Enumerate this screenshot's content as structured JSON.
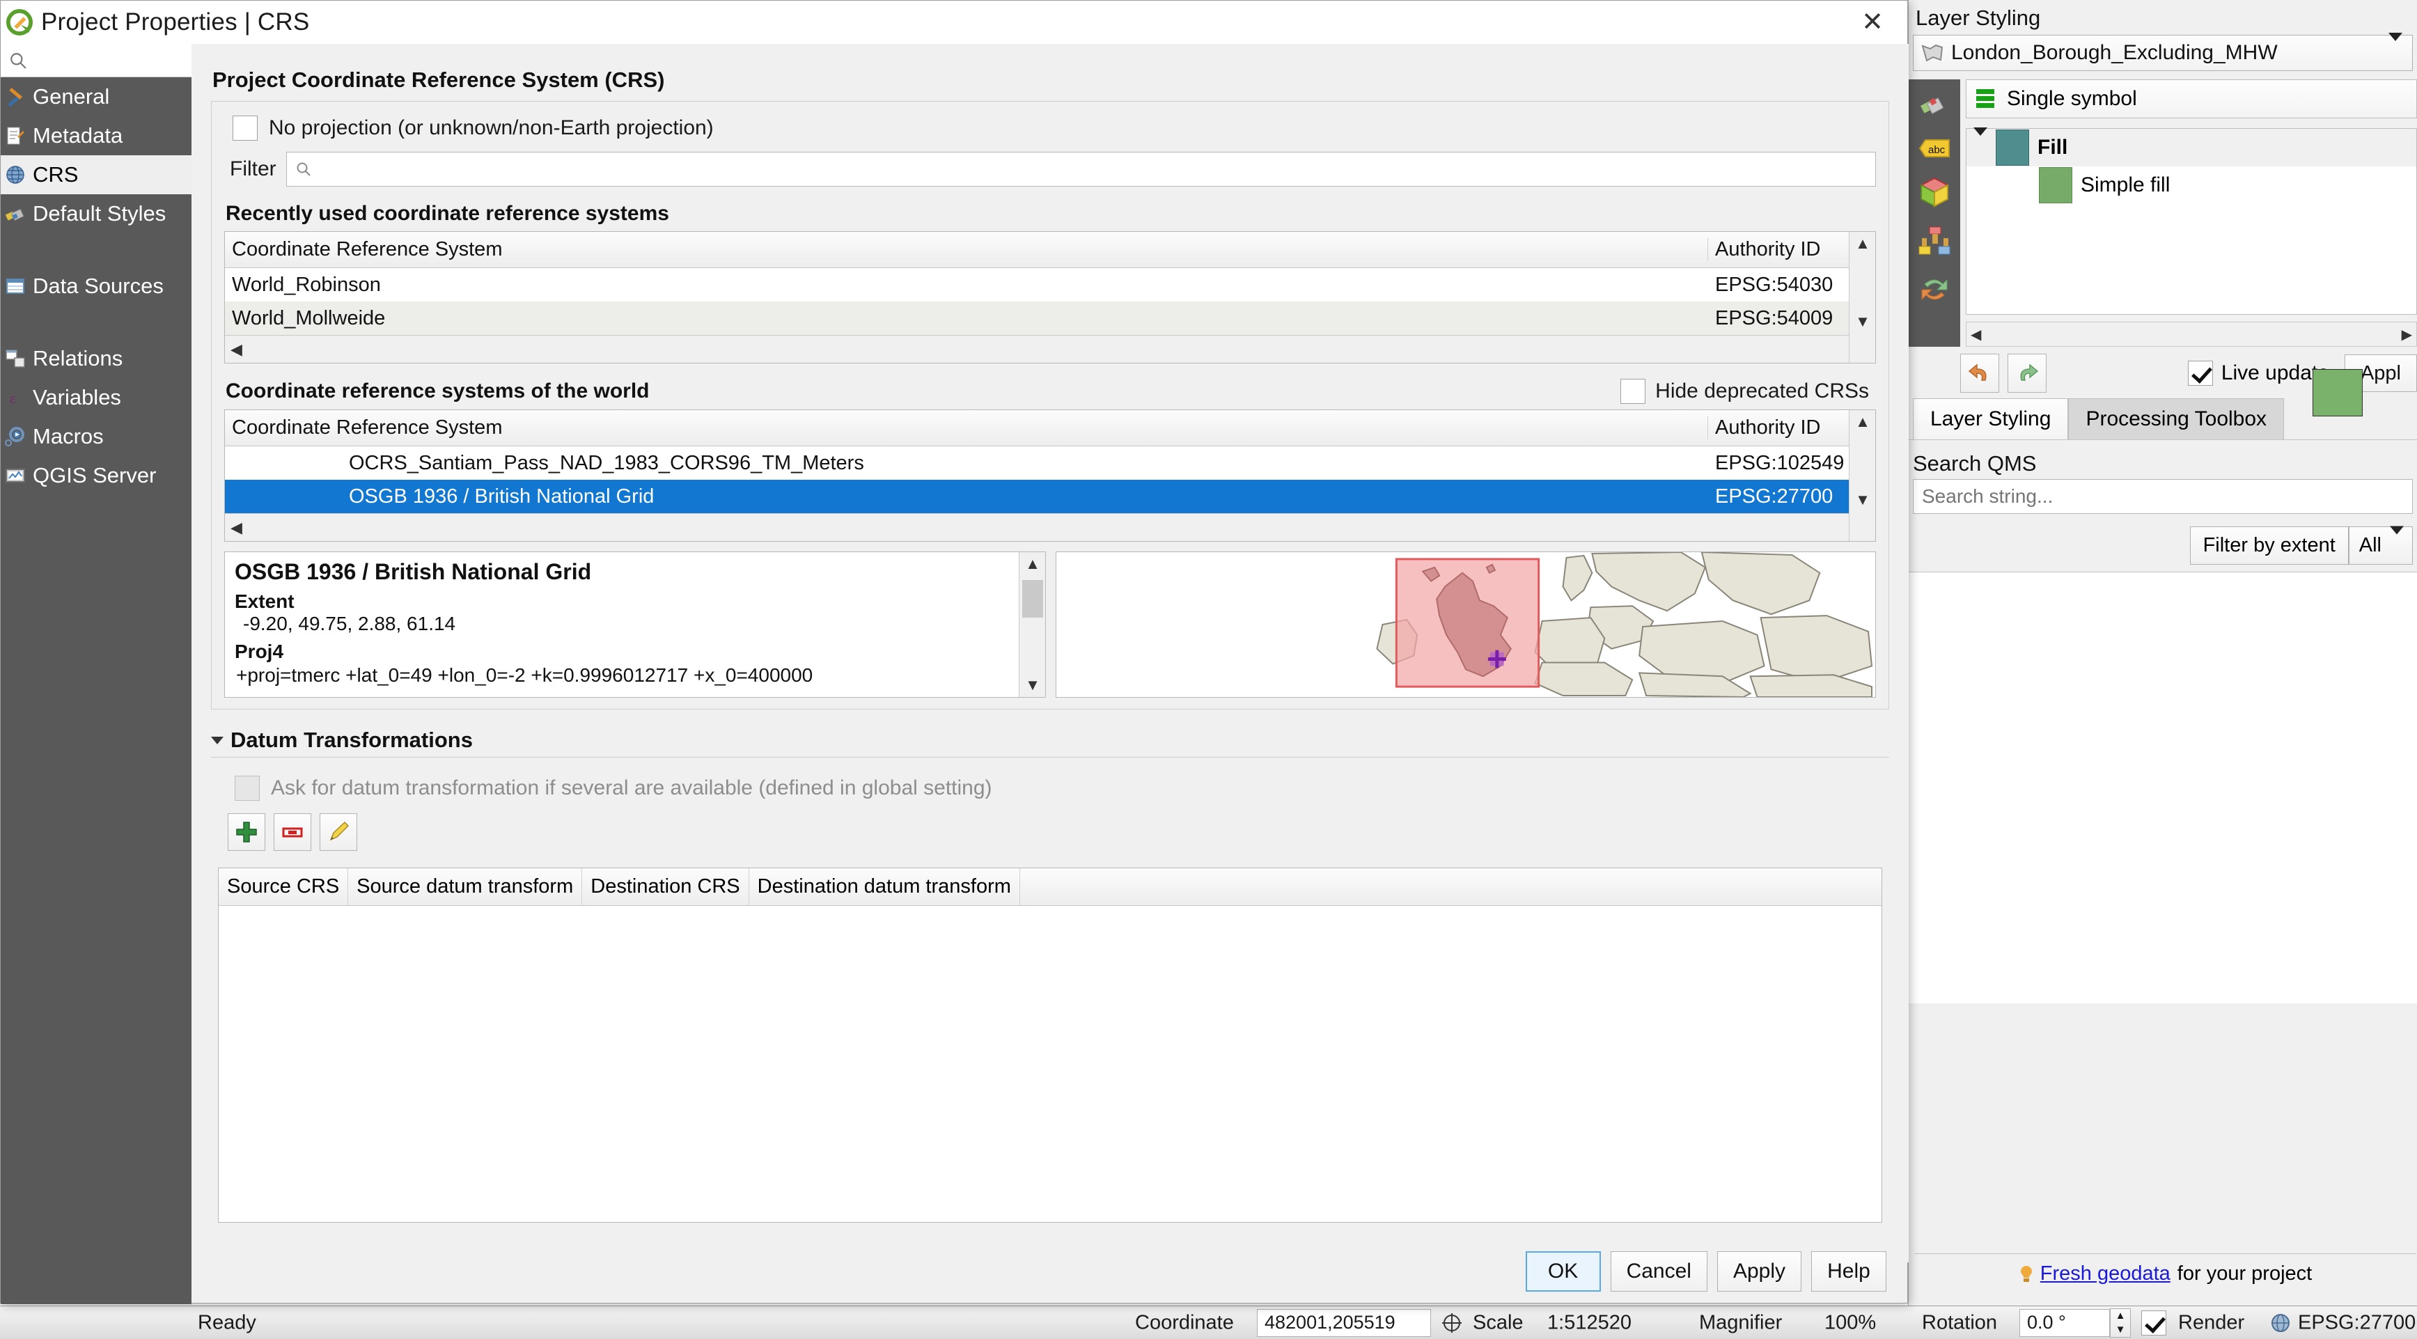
{
  "dialog": {
    "title": "Project Properties | CRS",
    "close_icon": "close-icon",
    "search_placeholder": "",
    "sidebar": [
      {
        "label": "General",
        "icon": "tools-icon",
        "active": false
      },
      {
        "label": "Metadata",
        "icon": "document-edit-icon",
        "active": false
      },
      {
        "label": "CRS",
        "icon": "globe-icon",
        "active": true
      },
      {
        "label": "Default Styles",
        "icon": "paintbrush-icon",
        "active": false
      },
      {
        "label": "Data Sources",
        "icon": "table-icon",
        "active": false
      },
      {
        "label": "Relations",
        "icon": "relations-icon",
        "active": false
      },
      {
        "label": "Variables",
        "icon": "epsilon-icon",
        "active": false
      },
      {
        "label": "Macros",
        "icon": "macro-gear-icon",
        "active": false
      },
      {
        "label": "QGIS Server",
        "icon": "server-image-icon",
        "active": false
      }
    ],
    "page_title": "Project Coordinate Reference System (CRS)",
    "no_projection_label": "No projection (or unknown/non-Earth projection)",
    "no_projection_checked": false,
    "filter_label": "Filter",
    "filter_value": "",
    "filter_placeholder": "",
    "recent_title": "Recently used coordinate reference systems",
    "world_title": "Coordinate reference systems of the world",
    "hide_deprecated_label": "Hide deprecated CRSs",
    "hide_deprecated_checked": false,
    "table_columns": [
      "Coordinate Reference System",
      "Authority ID"
    ],
    "recent_rows": [
      {
        "crs": "World_Robinson",
        "authority": "EPSG:54030",
        "selected": false
      },
      {
        "crs": "World_Mollweide",
        "authority": "EPSG:54009",
        "selected": false
      }
    ],
    "world_rows": [
      {
        "crs": "OCRS_Santiam_Pass_NAD_1983_CORS96_TM_Meters",
        "authority": "EPSG:102549",
        "selected": false
      },
      {
        "crs": "OSGB 1936 / British National Grid",
        "authority": "EPSG:27700",
        "selected": true
      }
    ],
    "detail": {
      "title": "OSGB 1936 / British National Grid",
      "extent_label": "Extent",
      "extent_value": "-9.20, 49.75, 2.88, 61.14",
      "proj4_label": "Proj4",
      "proj4_value": "+proj=tmerc +lat_0=49 +lon_0=-2 +k=0.9996012717 +x_0=400000"
    },
    "datum": {
      "section_label": "Datum Transformations",
      "ask_label": "Ask for datum transformation if several are available (defined in global setting)",
      "ask_checked": false,
      "buttons": [
        "add-datum-transform",
        "remove-datum-transform",
        "edit-datum-transform"
      ],
      "columns": [
        "Source CRS",
        "Source datum transform",
        "Destination CRS",
        "Destination datum transform"
      ],
      "rows": []
    },
    "buttons": [
      {
        "label": "OK",
        "default": true
      },
      {
        "label": "Cancel",
        "default": false
      },
      {
        "label": "Apply",
        "default": false
      },
      {
        "label": "Help",
        "default": false
      }
    ]
  },
  "right_panel": {
    "title": "Layer Styling",
    "layer_name": "London_Borough_Excluding_MHW",
    "renderer": "Single symbol",
    "tree": [
      {
        "label": "Fill",
        "level": 0,
        "color": "#4e8e8e"
      },
      {
        "label": "Simple fill",
        "level": 1,
        "color": "#77ab6a"
      }
    ],
    "live_update_label": "Live update",
    "live_update_checked": true,
    "apply_label": "Appl",
    "tabs": [
      {
        "label": "Layer Styling",
        "active": true
      },
      {
        "label": "Processing Toolbox",
        "active": false
      }
    ],
    "qms_title": "Search QMS",
    "qms_placeholder": "Search string...",
    "qms_value": "",
    "filter_by_extent_label": "Filter by extent",
    "filter_select_value": "All",
    "fresh_link": "Fresh geodata",
    "fresh_suffix": "for your project"
  },
  "statusbar": {
    "ready": "Ready",
    "coordinate_label": "Coordinate",
    "coordinate_value": "482001,205519",
    "scale_label": "Scale",
    "scale_value": "1:512520",
    "magnifier_label": "Magnifier",
    "magnifier_value": "100%",
    "rotation_label": "Rotation",
    "rotation_value": "0.0 °",
    "render_label": "Render",
    "render_checked": true,
    "crs_value": "EPSG:27700"
  },
  "colors": {
    "selection_blue": "#1177d1",
    "sidebar_dark": "#595959",
    "extent_box": "#f2a7a7",
    "land": "#e6e3d7",
    "fill_teal": "#4e8e8e",
    "fill_green": "#77ab6a"
  }
}
